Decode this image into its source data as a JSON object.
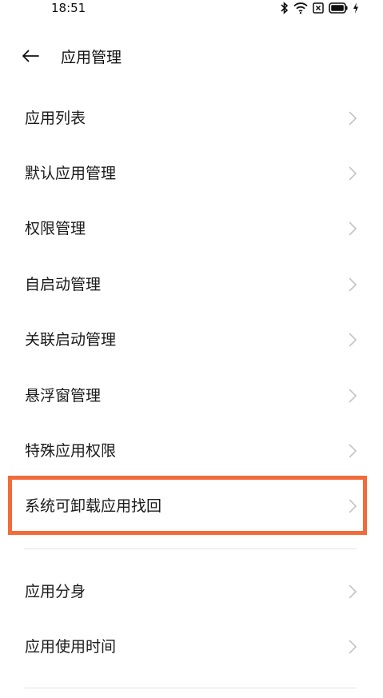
{
  "status_bar": {
    "time": "18:51",
    "icons": [
      "bluetooth-icon",
      "wifi-icon",
      "sim-off-icon",
      "battery-icon",
      "charging-icon"
    ]
  },
  "header": {
    "title": "应用管理",
    "back_icon": "arrow-left-icon"
  },
  "menu": {
    "items": [
      {
        "label": "应用列表"
      },
      {
        "label": "默认应用管理"
      },
      {
        "label": "权限管理"
      },
      {
        "label": "自启动管理"
      },
      {
        "label": "关联启动管理"
      },
      {
        "label": "悬浮窗管理"
      },
      {
        "label": "特殊应用权限"
      },
      {
        "label": "系统可卸载应用找回"
      }
    ]
  },
  "menu2": {
    "items": [
      {
        "label": "应用分身"
      },
      {
        "label": "应用使用时间"
      }
    ]
  },
  "colors": {
    "highlight": "#f26b3a",
    "chevron": "#c4c4c4",
    "divider": "#e3e3e3"
  }
}
